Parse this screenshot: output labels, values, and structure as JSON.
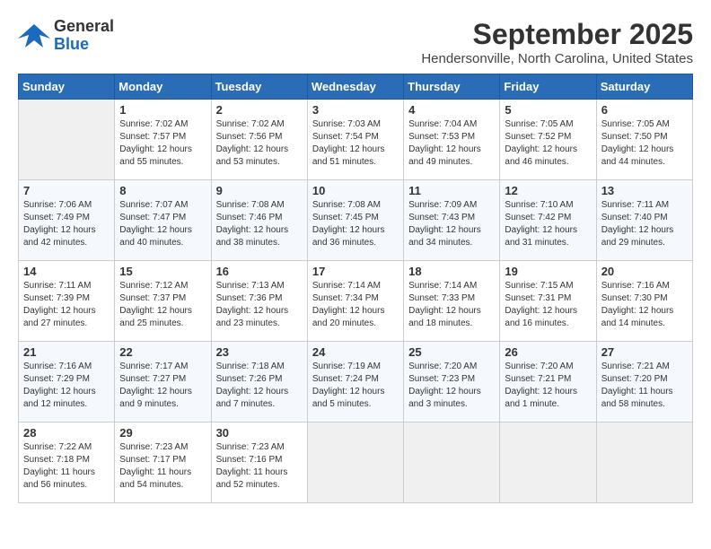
{
  "header": {
    "logo_general": "General",
    "logo_blue": "Blue",
    "month_title": "September 2025",
    "location": "Hendersonville, North Carolina, United States"
  },
  "weekdays": [
    "Sunday",
    "Monday",
    "Tuesday",
    "Wednesday",
    "Thursday",
    "Friday",
    "Saturday"
  ],
  "weeks": [
    [
      {
        "day": "",
        "info": ""
      },
      {
        "day": "1",
        "info": "Sunrise: 7:02 AM\nSunset: 7:57 PM\nDaylight: 12 hours\nand 55 minutes."
      },
      {
        "day": "2",
        "info": "Sunrise: 7:02 AM\nSunset: 7:56 PM\nDaylight: 12 hours\nand 53 minutes."
      },
      {
        "day": "3",
        "info": "Sunrise: 7:03 AM\nSunset: 7:54 PM\nDaylight: 12 hours\nand 51 minutes."
      },
      {
        "day": "4",
        "info": "Sunrise: 7:04 AM\nSunset: 7:53 PM\nDaylight: 12 hours\nand 49 minutes."
      },
      {
        "day": "5",
        "info": "Sunrise: 7:05 AM\nSunset: 7:52 PM\nDaylight: 12 hours\nand 46 minutes."
      },
      {
        "day": "6",
        "info": "Sunrise: 7:05 AM\nSunset: 7:50 PM\nDaylight: 12 hours\nand 44 minutes."
      }
    ],
    [
      {
        "day": "7",
        "info": "Sunrise: 7:06 AM\nSunset: 7:49 PM\nDaylight: 12 hours\nand 42 minutes."
      },
      {
        "day": "8",
        "info": "Sunrise: 7:07 AM\nSunset: 7:47 PM\nDaylight: 12 hours\nand 40 minutes."
      },
      {
        "day": "9",
        "info": "Sunrise: 7:08 AM\nSunset: 7:46 PM\nDaylight: 12 hours\nand 38 minutes."
      },
      {
        "day": "10",
        "info": "Sunrise: 7:08 AM\nSunset: 7:45 PM\nDaylight: 12 hours\nand 36 minutes."
      },
      {
        "day": "11",
        "info": "Sunrise: 7:09 AM\nSunset: 7:43 PM\nDaylight: 12 hours\nand 34 minutes."
      },
      {
        "day": "12",
        "info": "Sunrise: 7:10 AM\nSunset: 7:42 PM\nDaylight: 12 hours\nand 31 minutes."
      },
      {
        "day": "13",
        "info": "Sunrise: 7:11 AM\nSunset: 7:40 PM\nDaylight: 12 hours\nand 29 minutes."
      }
    ],
    [
      {
        "day": "14",
        "info": "Sunrise: 7:11 AM\nSunset: 7:39 PM\nDaylight: 12 hours\nand 27 minutes."
      },
      {
        "day": "15",
        "info": "Sunrise: 7:12 AM\nSunset: 7:37 PM\nDaylight: 12 hours\nand 25 minutes."
      },
      {
        "day": "16",
        "info": "Sunrise: 7:13 AM\nSunset: 7:36 PM\nDaylight: 12 hours\nand 23 minutes."
      },
      {
        "day": "17",
        "info": "Sunrise: 7:14 AM\nSunset: 7:34 PM\nDaylight: 12 hours\nand 20 minutes."
      },
      {
        "day": "18",
        "info": "Sunrise: 7:14 AM\nSunset: 7:33 PM\nDaylight: 12 hours\nand 18 minutes."
      },
      {
        "day": "19",
        "info": "Sunrise: 7:15 AM\nSunset: 7:31 PM\nDaylight: 12 hours\nand 16 minutes."
      },
      {
        "day": "20",
        "info": "Sunrise: 7:16 AM\nSunset: 7:30 PM\nDaylight: 12 hours\nand 14 minutes."
      }
    ],
    [
      {
        "day": "21",
        "info": "Sunrise: 7:16 AM\nSunset: 7:29 PM\nDaylight: 12 hours\nand 12 minutes."
      },
      {
        "day": "22",
        "info": "Sunrise: 7:17 AM\nSunset: 7:27 PM\nDaylight: 12 hours\nand 9 minutes."
      },
      {
        "day": "23",
        "info": "Sunrise: 7:18 AM\nSunset: 7:26 PM\nDaylight: 12 hours\nand 7 minutes."
      },
      {
        "day": "24",
        "info": "Sunrise: 7:19 AM\nSunset: 7:24 PM\nDaylight: 12 hours\nand 5 minutes."
      },
      {
        "day": "25",
        "info": "Sunrise: 7:20 AM\nSunset: 7:23 PM\nDaylight: 12 hours\nand 3 minutes."
      },
      {
        "day": "26",
        "info": "Sunrise: 7:20 AM\nSunset: 7:21 PM\nDaylight: 12 hours\nand 1 minute."
      },
      {
        "day": "27",
        "info": "Sunrise: 7:21 AM\nSunset: 7:20 PM\nDaylight: 11 hours\nand 58 minutes."
      }
    ],
    [
      {
        "day": "28",
        "info": "Sunrise: 7:22 AM\nSunset: 7:18 PM\nDaylight: 11 hours\nand 56 minutes."
      },
      {
        "day": "29",
        "info": "Sunrise: 7:23 AM\nSunset: 7:17 PM\nDaylight: 11 hours\nand 54 minutes."
      },
      {
        "day": "30",
        "info": "Sunrise: 7:23 AM\nSunset: 7:16 PM\nDaylight: 11 hours\nand 52 minutes."
      },
      {
        "day": "",
        "info": ""
      },
      {
        "day": "",
        "info": ""
      },
      {
        "day": "",
        "info": ""
      },
      {
        "day": "",
        "info": ""
      }
    ]
  ]
}
